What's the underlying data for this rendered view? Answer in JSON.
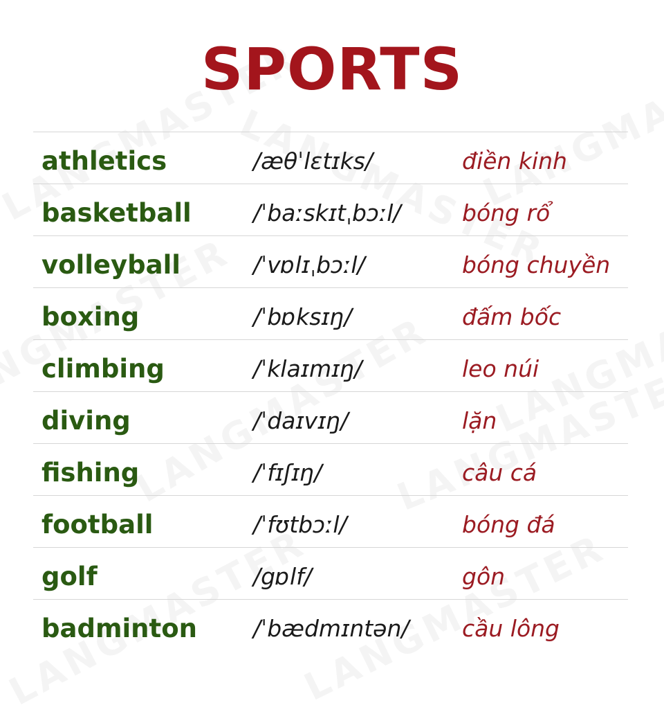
{
  "title": "SPORTS",
  "watermark_text": "LANGMASTER",
  "colors": {
    "title": "#a3151c",
    "word": "#2a5a12",
    "ipa": "#1a1a1a",
    "meaning": "#9b1b22",
    "divider": "#d6d6d6"
  },
  "rows": [
    {
      "word": "athletics",
      "ipa": "/æθˈlɛtɪks/",
      "meaning": "điền kinh"
    },
    {
      "word": "basketball",
      "ipa": "/ˈbaːskɪtˌbɔːl/",
      "meaning": "bóng rổ"
    },
    {
      "word": "volleyball",
      "ipa": "/ˈvɒlɪˌbɔːl/",
      "meaning": "bóng chuyền"
    },
    {
      "word": "boxing",
      "ipa": "/ˈbɒksɪŋ/",
      "meaning": "đấm bốc"
    },
    {
      "word": "climbing",
      "ipa": "/ˈklaɪmɪŋ/",
      "meaning": "leo núi"
    },
    {
      "word": "diving",
      "ipa": "/ˈdaɪvɪŋ/",
      "meaning": "lặn"
    },
    {
      "word": "fishing",
      "ipa": "/ˈfɪʃɪŋ/",
      "meaning": "câu cá"
    },
    {
      "word": "football",
      "ipa": "/ˈfʊtbɔːl/",
      "meaning": "bóng đá"
    },
    {
      "word": "golf",
      "ipa": "/gɒlf/",
      "meaning": "gôn"
    },
    {
      "word": "badminton",
      "ipa": "/ˈbædmɪntən/",
      "meaning": "cầu lông"
    }
  ]
}
